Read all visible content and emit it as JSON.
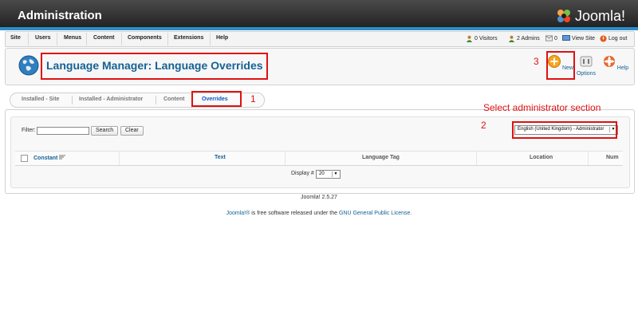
{
  "header": {
    "title": "Administration",
    "logo_text": "Joomla!"
  },
  "menu": {
    "items": [
      "Site",
      "Users",
      "Menus",
      "Content",
      "Components",
      "Extensions",
      "Help"
    ],
    "status": {
      "visitors": "0 Visitors",
      "admins": "2 Admins",
      "messages": "0",
      "view_site": "View Site",
      "logout": "Log out"
    }
  },
  "toolbar": {
    "title": "Language Manager: Language Overrides",
    "buttons": {
      "new": "New",
      "options": "Options",
      "help": "Help"
    }
  },
  "tabs": [
    "Installed - Site",
    "Installed - Administrator",
    "Content",
    "Overrides"
  ],
  "filter": {
    "label": "Filter:",
    "value": "",
    "search_button": "Search",
    "clear_button": "Clear",
    "language_select": "English (United Kingdom) - Administrator"
  },
  "table": {
    "columns": [
      "Constant",
      "Text",
      "Language Tag",
      "Location",
      "Num"
    ],
    "display_label": "Display #",
    "display_value": "20"
  },
  "annotations": {
    "overrides_marker": "1",
    "section_marker": "2",
    "new_marker": "3",
    "section_note": "Select administrator section"
  },
  "footer": {
    "version": "Joomla! 2.5.27",
    "license_prefix": "Joomla!®",
    "license_mid": " is free software released under the ",
    "license_link": "GNU General Public License",
    "license_suffix": "."
  },
  "colors": {
    "accent": "#146295",
    "annotation": "#e01111",
    "brand_bar": "#2c8ec9"
  }
}
